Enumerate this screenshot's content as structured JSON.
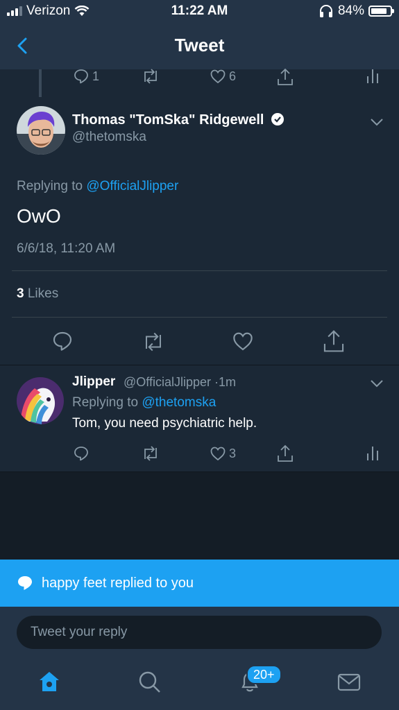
{
  "status_bar": {
    "carrier": "Verizon",
    "time": "11:22 AM",
    "battery": "84%"
  },
  "nav": {
    "title": "Tweet"
  },
  "parent_actions": {
    "replies": "1",
    "likes": "6"
  },
  "tweet": {
    "author_name": "Thomas \"TomSka\" Ridgewell",
    "author_handle": "@thetomska",
    "replying_prefix": "Replying to",
    "replying_to": "@OfficialJlipper",
    "text": "OwO",
    "timestamp": "6/6/18, 11:20 AM",
    "likes_count": "3",
    "likes_label": "Likes"
  },
  "reply": {
    "author_name": "Jlipper",
    "author_handle": "@OfficialJlipper",
    "separator": "·",
    "age": "1m",
    "replying_prefix": "Replying to",
    "replying_to": "@thetomska",
    "text": "Tom, you need psychiatric help.",
    "likes": "3"
  },
  "toast": {
    "text": "happy feet replied to you"
  },
  "composer": {
    "placeholder": "Tweet your reply"
  },
  "tabbar": {
    "notifications_badge": "20+"
  },
  "colors": {
    "accent": "#1da1f2",
    "bg": "#141d26",
    "panel": "#1b2836",
    "bar": "#243447",
    "muted": "#8899a6"
  },
  "icons": [
    "back-chevron-icon",
    "reply-icon",
    "retweet-icon",
    "like-icon",
    "share-icon",
    "analytics-icon",
    "verified-badge-icon",
    "chevron-down-icon",
    "speech-bubble-icon",
    "home-icon",
    "search-icon",
    "bell-icon",
    "mail-icon"
  ]
}
